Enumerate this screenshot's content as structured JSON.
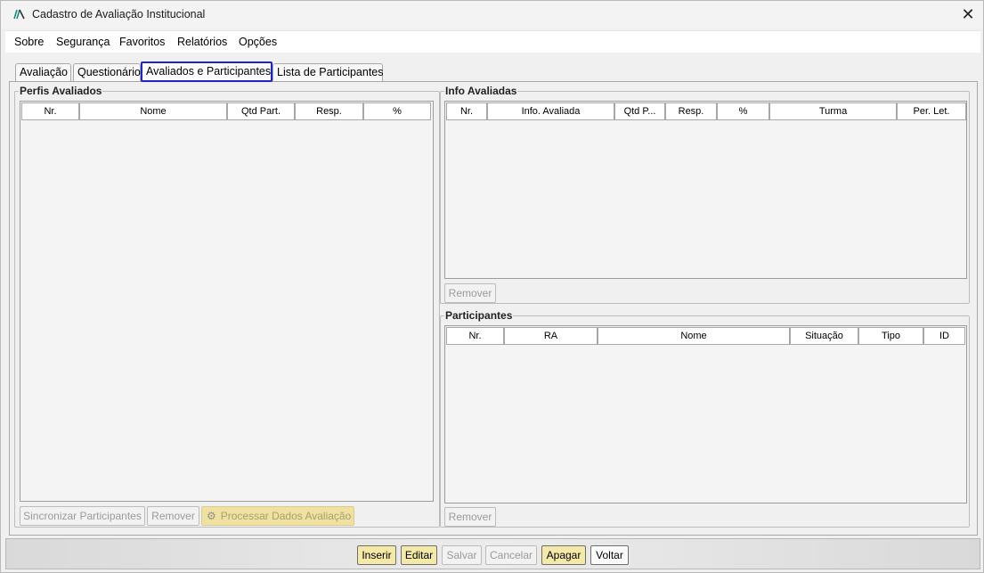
{
  "window": {
    "title": "Cadastro de Avaliação Institucional",
    "close_glyph": "✕",
    "icon": "app-logo-icon"
  },
  "menu": [
    "Sobre",
    "Segurança",
    "Favoritos",
    "Relatórios",
    "Opções"
  ],
  "tabs": [
    {
      "label": "Avaliação",
      "selected": false
    },
    {
      "label": "Questionário",
      "selected": false
    },
    {
      "label": "Avaliados e Participantes",
      "selected": true
    },
    {
      "label": "Lista de Participantes",
      "selected": false
    }
  ],
  "perfis": {
    "title": "Perfis Avaliados",
    "columns": [
      "Nr.",
      "Nome",
      "Qtd Part.",
      "Resp.",
      "%"
    ],
    "buttons": {
      "sincronizar": "Sincronizar Participantes",
      "remover": "Remover",
      "processar": "Processar Dados Avaliação"
    },
    "processar_icon": "gears-icon"
  },
  "info": {
    "title": "Info Avaliadas",
    "columns": [
      "Nr.",
      "Info. Avaliada",
      "Qtd P...",
      "Resp.",
      "%",
      "Turma",
      "Per. Let."
    ],
    "remover": "Remover"
  },
  "participantes": {
    "title": "Participantes",
    "columns": [
      "Nr.",
      "RA",
      "Nome",
      "Situação",
      "Tipo",
      "ID"
    ],
    "remover": "Remover"
  },
  "footer": {
    "inserir": "Inserir",
    "editar": "Editar",
    "salvar": "Salvar",
    "cancelar": "Cancelar",
    "apagar": "Apagar",
    "voltar": "Voltar"
  },
  "colors": {
    "selected_tab_border": "#1e22c8",
    "active_button": "#f5e9a8"
  }
}
